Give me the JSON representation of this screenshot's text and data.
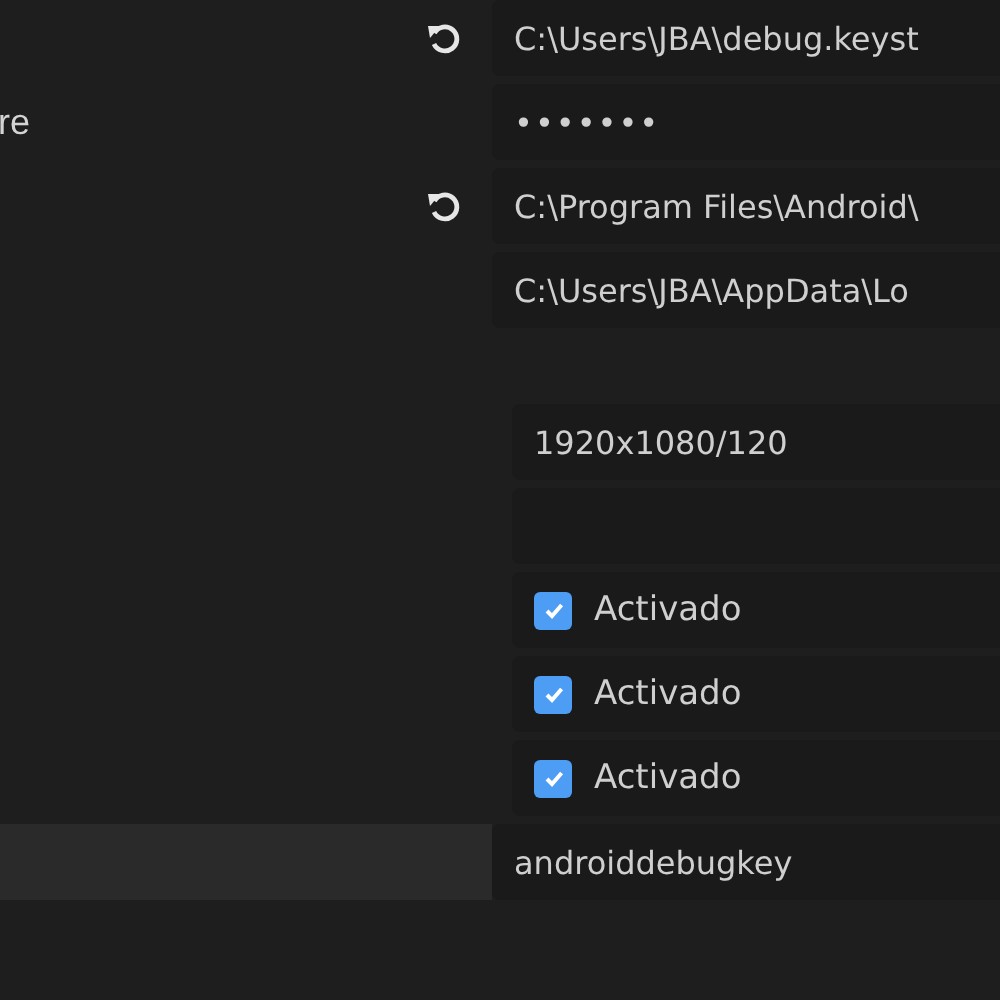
{
  "rows": [
    {
      "kind": "text",
      "value": "C:\\Users\\JBA\\debug.keyst",
      "reset": true,
      "inset": false,
      "highlighted": false
    },
    {
      "kind": "password",
      "label": "re",
      "value": "•••••••",
      "inset": false,
      "highlighted": false
    },
    {
      "kind": "text",
      "value": "C:\\Program Files\\Android\\",
      "reset": true,
      "inset": false,
      "highlighted": false
    },
    {
      "kind": "text",
      "value": "C:\\Users\\JBA\\AppData\\Lo",
      "inset": false,
      "highlighted": false
    },
    {
      "kind": "spacer"
    },
    {
      "kind": "text",
      "value": "1920x1080/120",
      "inset": true,
      "highlighted": false
    },
    {
      "kind": "text",
      "inset": true,
      "highlighted": false
    },
    {
      "kind": "checkbox",
      "value": "Activado",
      "checked": true,
      "inset": true
    },
    {
      "kind": "checkbox",
      "value": "Activado",
      "checked": true,
      "inset": true
    },
    {
      "kind": "checkbox",
      "value": "Activado",
      "checked": true,
      "inset": true
    },
    {
      "kind": "text",
      "value": "androiddebugkey",
      "inset": false,
      "highlighted": true
    }
  ]
}
